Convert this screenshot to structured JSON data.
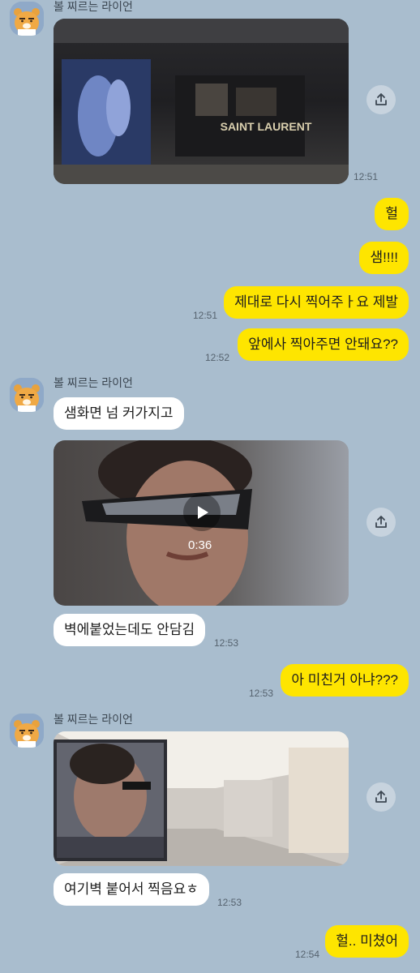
{
  "messages": {
    "m1": {
      "sender": "볼 찌르는 라이언",
      "time": "12:51"
    },
    "m2": {
      "text": "헐"
    },
    "m3": {
      "text": "샘!!!!"
    },
    "m4": {
      "text": "제대로 다시 찍어주ㅏ요 제발",
      "time": "12:51"
    },
    "m5": {
      "text": "앞에사 찍아주면 안돼요??",
      "time": "12:52"
    },
    "m6": {
      "sender": "볼 찌르는 라이언",
      "text": "샘화면 넘 커가지고"
    },
    "m7": {
      "duration": "0:36"
    },
    "m8": {
      "text": "벽에붙었는데도 안담김",
      "time": "12:53"
    },
    "m9": {
      "text": "아 미친거 아냐???",
      "time": "12:53"
    },
    "m10": {
      "sender": "볼 찌르는 라이언"
    },
    "m11": {
      "text": "여기벽 붙어서 찍음요ㅎ",
      "time": "12:53"
    },
    "m12": {
      "text": "헐.. 미쳤어",
      "time": "12:54"
    }
  },
  "photo1_sign": "SAINT LAURENT",
  "colors": {
    "background": "#a9bdce",
    "outgoing": "#fee500",
    "incoming": "#ffffff"
  }
}
